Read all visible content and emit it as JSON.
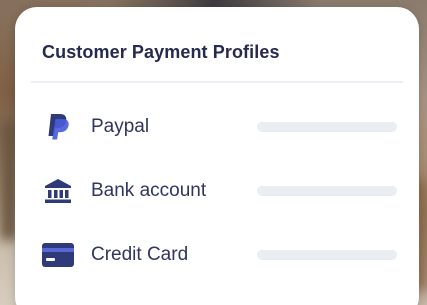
{
  "card": {
    "title": "Customer Payment Profiles"
  },
  "methods": [
    {
      "label": "Paypal",
      "icon": "paypal-icon"
    },
    {
      "label": "Bank account",
      "icon": "bank-icon"
    },
    {
      "label": "Credit Card",
      "icon": "credit-card-icon"
    }
  ],
  "colors": {
    "accent": "#2f3a78",
    "title": "#262a4f",
    "placeholder_bar": "#eaedf1"
  }
}
